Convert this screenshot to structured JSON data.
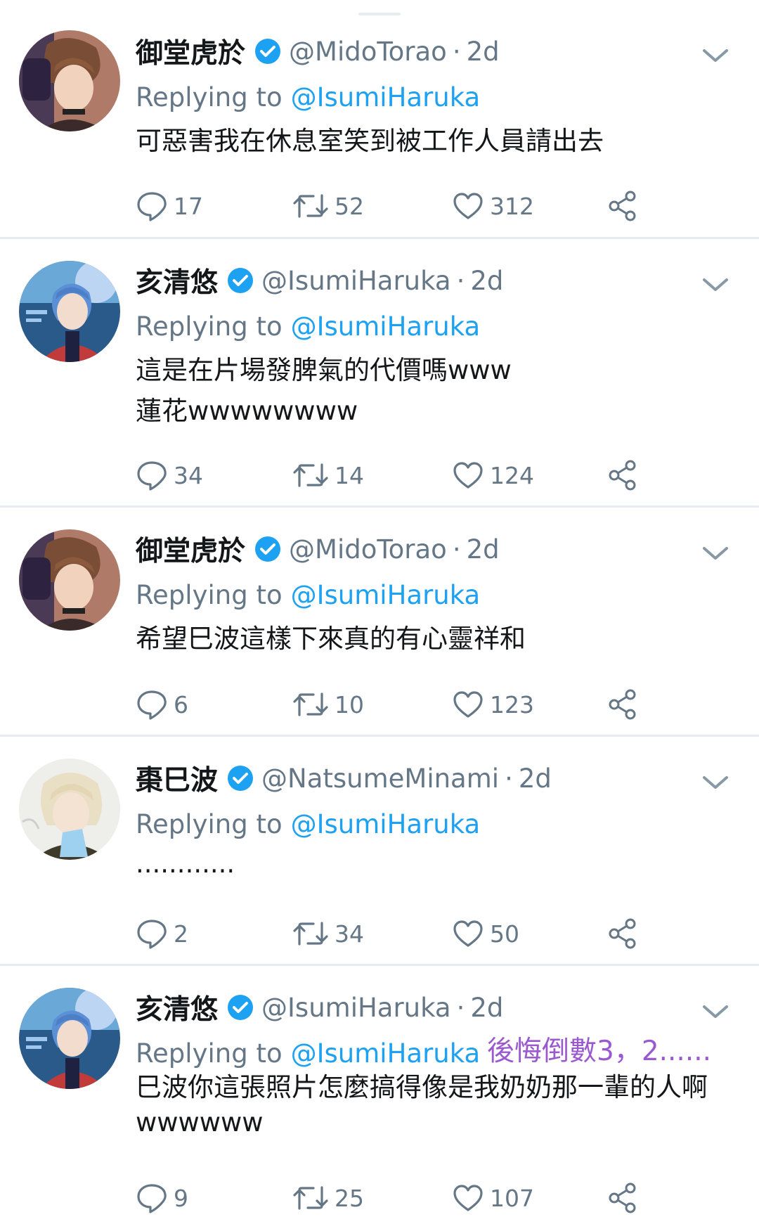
{
  "colors": {
    "accent": "#1da1f2",
    "secondary_text": "#657786",
    "divider": "#e6ecf0",
    "annotation": "#9b59d0"
  },
  "icons": {
    "reply": "comment-icon",
    "retweet": "retweet-icon",
    "like": "heart-icon",
    "share": "share-icon",
    "verified": "verified-badge-icon",
    "menu": "chevron-down-icon"
  },
  "tweets": [
    {
      "name": "御堂虎於",
      "handle": "@MidoTorao",
      "time": "2d",
      "reply_label": "Replying to",
      "reply_to": "@IsumiHaruka",
      "text": [
        "可惡害我在休息室笑到被工作人員請出去"
      ],
      "replies": "17",
      "retweets": "52",
      "likes": "312"
    },
    {
      "name": "亥清悠",
      "handle": "@IsumiHaruka",
      "time": "2d",
      "reply_label": "Replying to",
      "reply_to": "@IsumiHaruka",
      "text": [
        "這是在片場發脾氣的代價嗎www",
        "蓮花wwwwwwww"
      ],
      "replies": "34",
      "retweets": "14",
      "likes": "124"
    },
    {
      "name": "御堂虎於",
      "handle": "@MidoTorao",
      "time": "2d",
      "reply_label": "Replying to",
      "reply_to": "@IsumiHaruka",
      "text": [
        "希望巳波這樣下來真的有心靈祥和"
      ],
      "replies": "6",
      "retweets": "10",
      "likes": "123"
    },
    {
      "name": "棗巳波",
      "handle": "@NatsumeMinami",
      "time": "2d",
      "reply_label": "Replying to",
      "reply_to": "@IsumiHaruka",
      "text": [
        "............"
      ],
      "replies": "2",
      "retweets": "34",
      "likes": "50"
    },
    {
      "name": "亥清悠",
      "handle": "@IsumiHaruka",
      "time": "2d",
      "reply_label": "Replying to",
      "reply_to": "@IsumiHaruka",
      "text": [
        "巳波你這張照片怎麼搞得像是我奶奶那一輩的人啊",
        "wwwwww"
      ],
      "replies": "9",
      "retweets": "25",
      "likes": "107"
    }
  ],
  "overlay_note": "後悔倒數3，2......"
}
